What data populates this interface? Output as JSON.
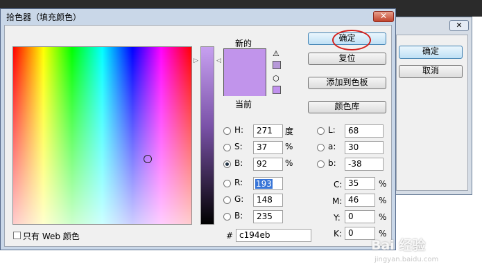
{
  "dialog": {
    "title": "拾色器（填充颜色）",
    "close_glyph": "✕",
    "buttons": {
      "ok": "确定",
      "reset": "复位",
      "add_to_swatches": "添加到色板",
      "color_libraries": "颜色库"
    },
    "new_label": "新的",
    "current_label": "当前",
    "new_color": "#c194eb",
    "current_color": "#c194eb",
    "web_only_label": "只有 Web 颜色",
    "hsb": [
      {
        "label": "H:",
        "value": "271",
        "unit": "度",
        "selected": false
      },
      {
        "label": "S:",
        "value": "37",
        "unit": "%",
        "selected": false
      },
      {
        "label": "B:",
        "value": "92",
        "unit": "%",
        "selected": true
      }
    ],
    "lab": [
      {
        "label": "L:",
        "value": "68"
      },
      {
        "label": "a:",
        "value": "30"
      },
      {
        "label": "b:",
        "value": "-38"
      }
    ],
    "rgb": [
      {
        "label": "R:",
        "value": "193"
      },
      {
        "label": "G:",
        "value": "148"
      },
      {
        "label": "B:",
        "value": "235"
      }
    ],
    "cmyk": [
      {
        "label": "C:",
        "value": "35",
        "unit": "%"
      },
      {
        "label": "M:",
        "value": "46",
        "unit": "%"
      },
      {
        "label": "Y:",
        "value": "0",
        "unit": "%"
      },
      {
        "label": "K:",
        "value": "0",
        "unit": "%"
      }
    ],
    "hex_label": "#",
    "hex_value": "c194eb"
  },
  "background_dialog": {
    "close_glyph": "✕",
    "ok": "确定",
    "cancel": "取消"
  },
  "watermark": {
    "text": "Bai 经验",
    "url": "jingyan.baidu.com"
  },
  "colors": {
    "title_bar": "#c9d7e8",
    "client": "#f0f0f0",
    "highlight": "#3875d7",
    "annotation_circle": "#d3201c"
  }
}
